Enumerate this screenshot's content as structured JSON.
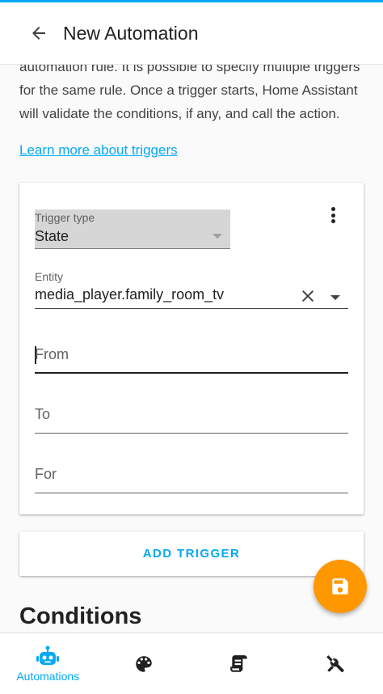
{
  "appbar": {
    "title": "New Automation",
    "back_icon": "arrow-left-icon"
  },
  "intro": {
    "text": "automation rule. It is possible to specify multiple triggers for the same rule. Once a trigger starts, Home Assistant will validate the conditions, if any, and call the action.",
    "learn_more_link": "Learn more about triggers"
  },
  "trigger": {
    "type_label": "Trigger type",
    "type_value": "State",
    "menu_icon": "dots-vertical-icon",
    "entity_label": "Entity",
    "entity_value": "media_player.family_room_tv",
    "from_placeholder": "From",
    "to_placeholder": "To",
    "for_placeholder": "For"
  },
  "add_trigger_label": "ADD TRIGGER",
  "conditions_title": "Conditions",
  "fab": {
    "icon": "save-icon",
    "color": "#ff9800"
  },
  "bottom_nav": {
    "items": [
      {
        "icon": "robot-icon",
        "label": "Automations",
        "active": true
      },
      {
        "icon": "palette-icon",
        "label": ""
      },
      {
        "icon": "script-icon",
        "label": ""
      },
      {
        "icon": "tools-icon",
        "label": ""
      }
    ]
  },
  "colors": {
    "accent": "#03a9f4",
    "fab": "#ff9800",
    "text": "#212121"
  }
}
